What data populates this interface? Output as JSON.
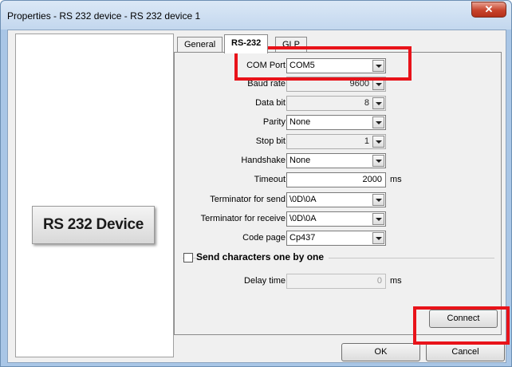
{
  "window": {
    "title": "Properties - RS 232 device - RS 232 device 1",
    "close_icon": "close-icon"
  },
  "left_panel": {
    "device_label": "RS 232 Device"
  },
  "tabs": [
    {
      "label": "General",
      "active": false
    },
    {
      "label": "RS-232",
      "active": true
    },
    {
      "label": "GLP",
      "active": false
    }
  ],
  "form": {
    "com_port": {
      "label": "COM Port",
      "value": "COM5"
    },
    "baud_rate": {
      "label": "Baud rate",
      "value": "9600"
    },
    "data_bit": {
      "label": "Data bit",
      "value": "8"
    },
    "parity": {
      "label": "Parity",
      "value": "None"
    },
    "stop_bit": {
      "label": "Stop bit",
      "value": "1"
    },
    "handshake": {
      "label": "Handshake",
      "value": "None"
    },
    "timeout": {
      "label": "Timeout",
      "value": "2000",
      "unit": "ms"
    },
    "terminator_send": {
      "label": "Terminator for send",
      "value": "\\0D\\0A"
    },
    "terminator_receive": {
      "label": "Terminator for receive",
      "value": "\\0D\\0A"
    },
    "code_page": {
      "label": "Code page",
      "value": "Cp437"
    },
    "send_one_by_one": {
      "label": "Send characters one by one",
      "checked": false
    },
    "delay_time": {
      "label": "Delay time",
      "value": "0",
      "unit": "ms"
    }
  },
  "buttons": {
    "connect": "Connect",
    "ok": "OK",
    "cancel": "Cancel"
  },
  "colors": {
    "highlight": "#e8131a",
    "title_bar": "#c3d7ee"
  }
}
